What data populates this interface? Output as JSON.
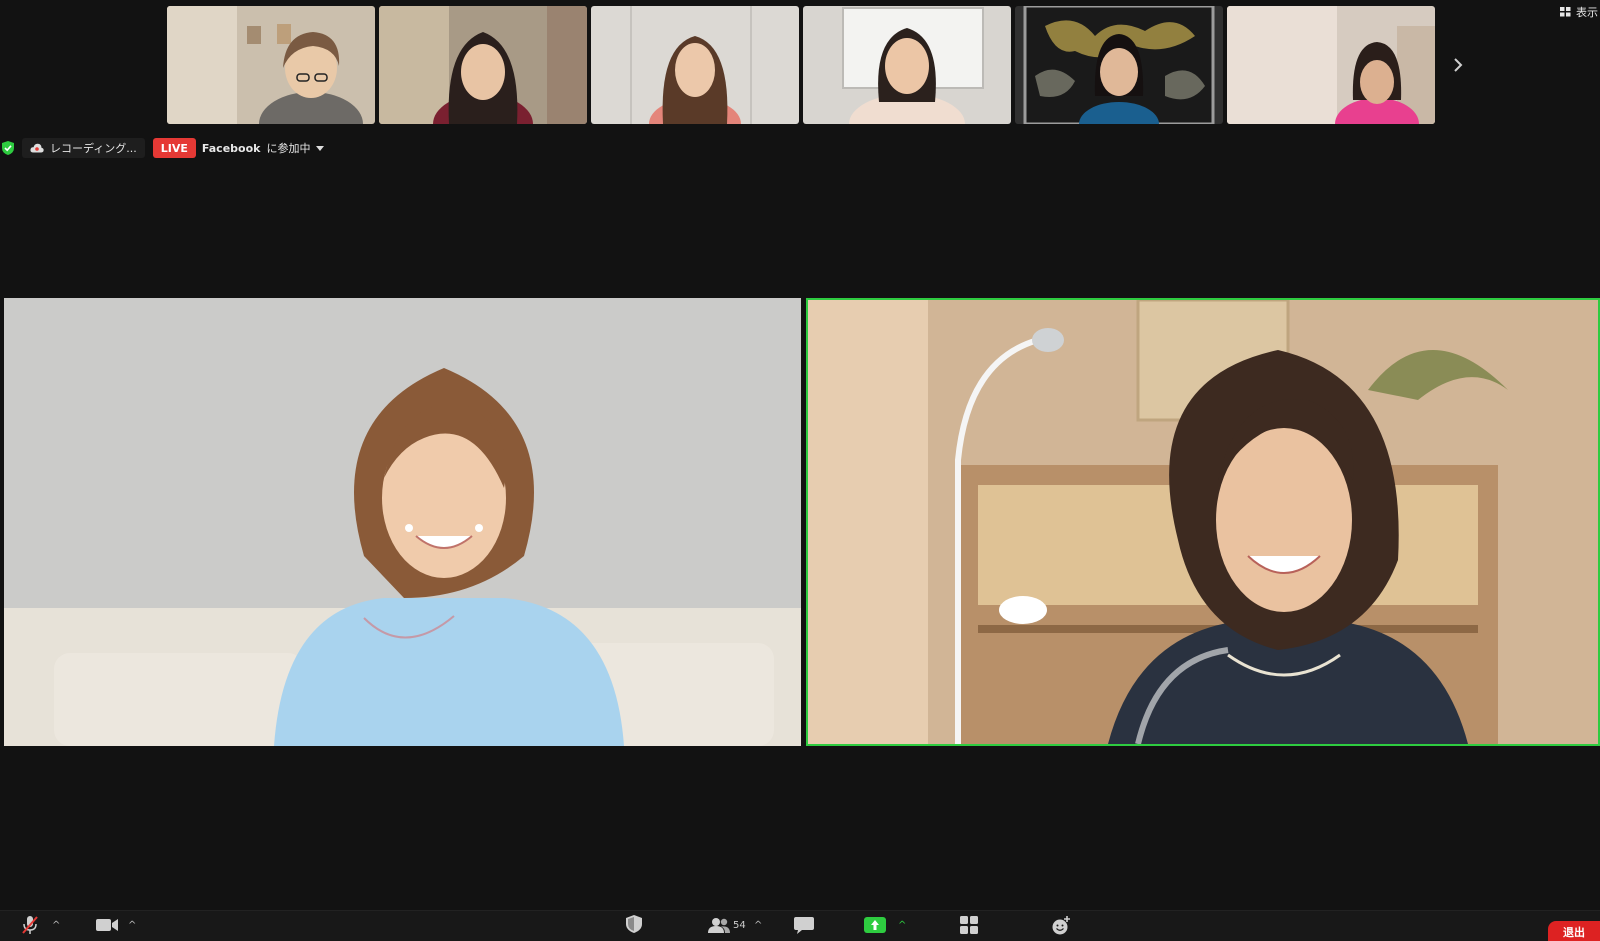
{
  "view_button": {
    "label": "表示",
    "icon": "grid-view-icon"
  },
  "status": {
    "recording_label": "レコーディング...",
    "live_badge": "LIVE",
    "live_platform": "Facebook",
    "live_status": "に参加中",
    "shield_color": "#2ecc40"
  },
  "filmstrip": {
    "participants": [
      {
        "bg": "#cbbfad"
      },
      {
        "bg": "#a89a86"
      },
      {
        "bg": "#dcd9d4"
      },
      {
        "bg": "#d8d5d0"
      },
      {
        "bg": "#303030"
      },
      {
        "bg": "#d6cbc0"
      }
    ]
  },
  "main_tiles": [
    {
      "id": "left",
      "bg": "#cbcbc9",
      "active": false
    },
    {
      "id": "right",
      "bg": "#d1b596",
      "active": true,
      "border_color": "#2ecc40"
    }
  ],
  "toolbar": {
    "participants_count": "54",
    "leave_label": "退出",
    "share_color": "#2ecc40",
    "leave_color": "#dd2222"
  }
}
